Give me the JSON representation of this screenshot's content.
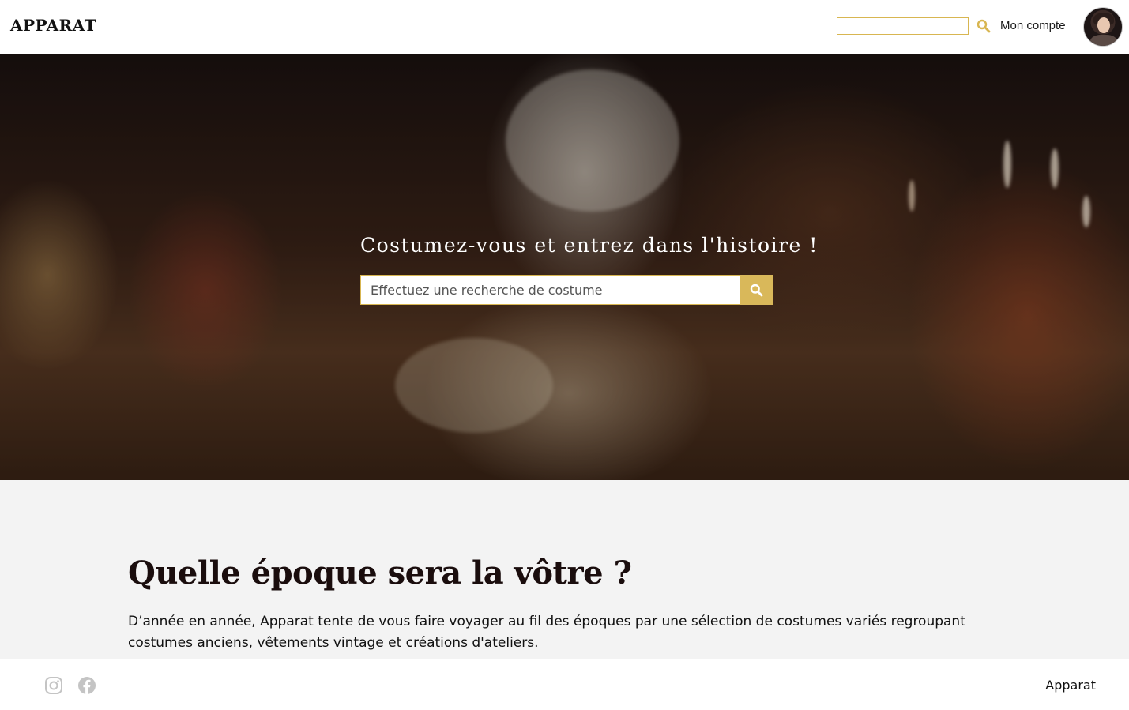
{
  "header": {
    "logo": "APPARAT",
    "search_value": "",
    "search_icon": "search-icon",
    "account_label": "Mon compte",
    "avatar_icon": "avatar"
  },
  "hero": {
    "title": "Costumez-vous et entrez dans l'histoire !",
    "search_placeholder": "Effectuez une recherche de costume",
    "search_button_icon": "search-icon"
  },
  "section": {
    "title": "Quelle époque sera la vôtre ?",
    "text": "D’année en année, Apparat tente de vous faire voyager au fil des époques par une sélection de costumes variés regroupant costumes anciens, vêtements vintage et créations d'ateliers."
  },
  "footer": {
    "icons": [
      "instagram-icon",
      "facebook-icon"
    ],
    "brand": "Apparat"
  },
  "colors": {
    "accent": "#d9b85a",
    "section_bg": "#f3f3f3",
    "title_color": "#1a0d0d"
  }
}
